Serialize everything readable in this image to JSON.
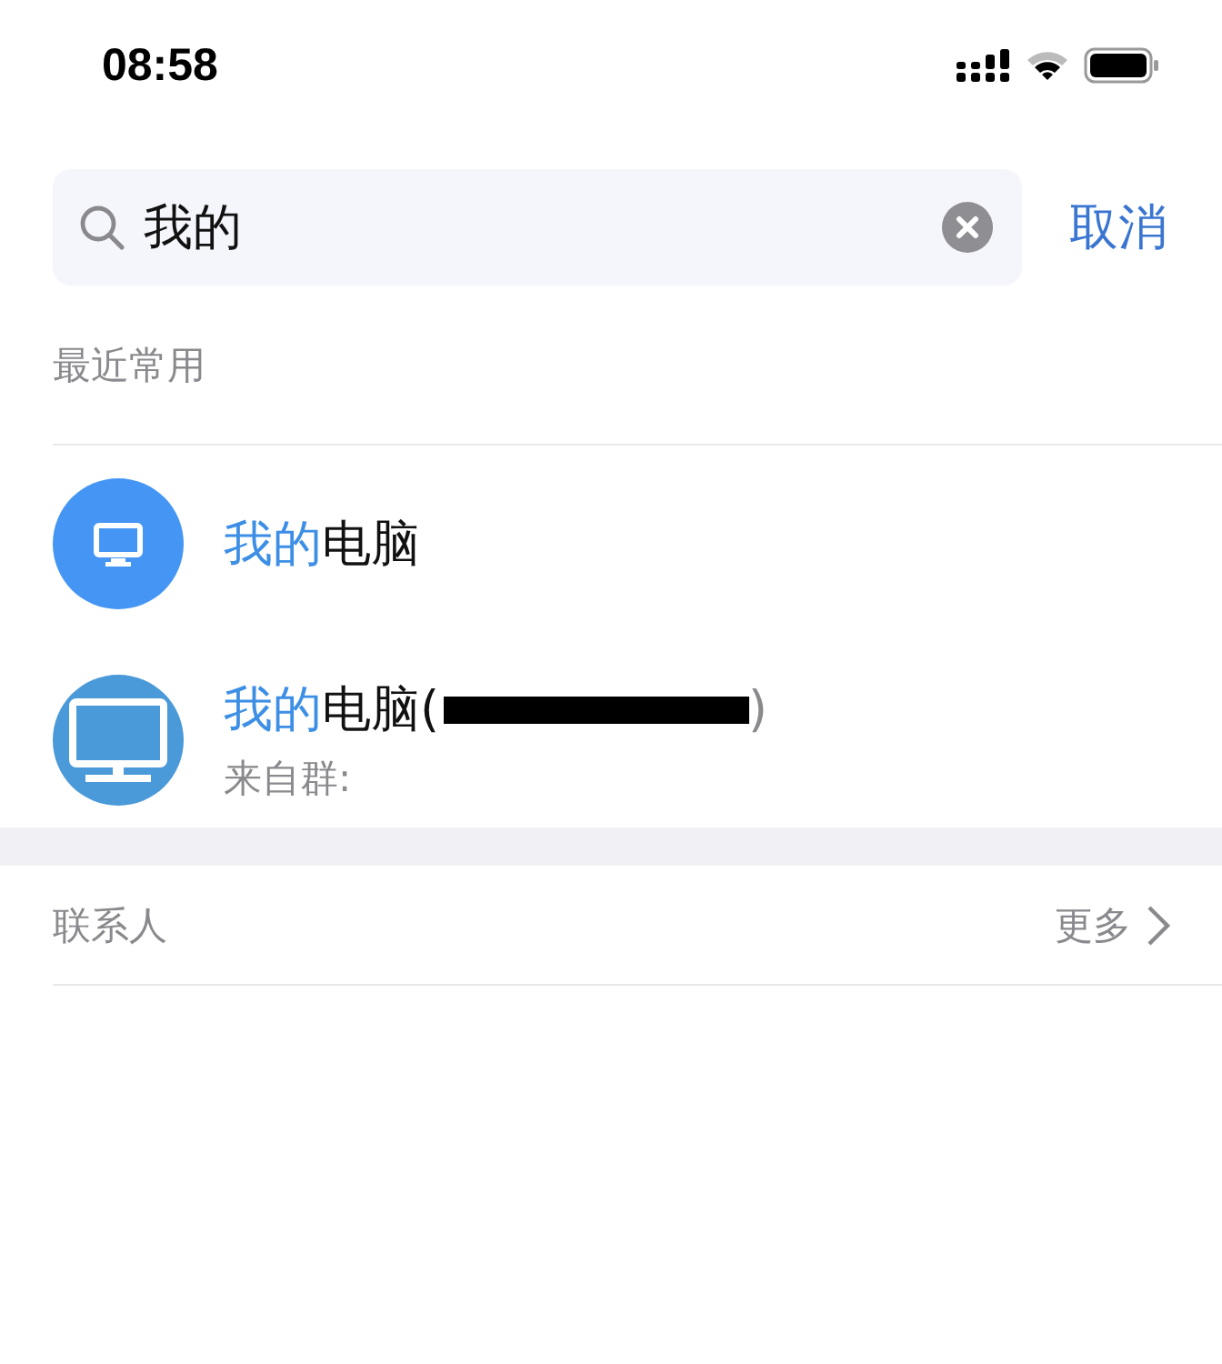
{
  "status_bar": {
    "time": "08:58"
  },
  "search": {
    "value": "我的",
    "cancel": "取消"
  },
  "recent": {
    "heading": "最近常用",
    "items": [
      {
        "kind": "device",
        "match": "我的",
        "rest": "电脑",
        "redacted": false
      },
      {
        "kind": "group",
        "match": "我的",
        "rest": "电脑(",
        "redacted": true,
        "suffix": ")",
        "subtitle": "来自群:"
      }
    ]
  },
  "contacts": {
    "heading": "联系人",
    "more": "更多"
  }
}
